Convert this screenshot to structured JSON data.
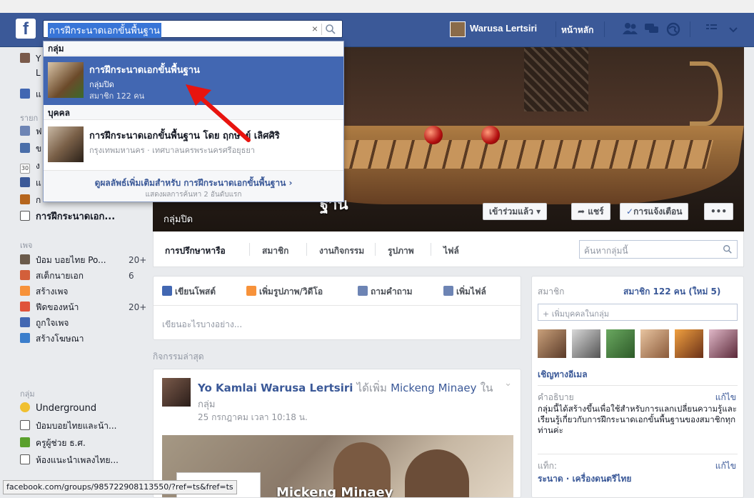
{
  "topbar": {
    "search_value": "การฝึกระนาดเอกขั้นพื้นฐาน",
    "clear_glyph": "×",
    "profile_name": "Warusa Lertsiri",
    "home_label": "หน้าหลัก"
  },
  "dropdown": {
    "groups_header": "กลุ่ม",
    "group_result": {
      "title": "การฝึกระนาดเอกขั้นพื้นฐาน",
      "privacy": "กลุ่มปิด",
      "members": "สมาชิก 122 คน"
    },
    "people_header": "บุคคล",
    "person_result": {
      "title": "การฝึกระนาดเอกขั้นพื้นฐาน โดย ฤกษาย์ เลิศศิริ",
      "location": "กรุงเทพมหานคร · เทศบาลนครพระนครศรีอยุธยา"
    },
    "more_results": "ดูผลลัพธ์เพิ่มเติมสำหรับ การฝึกระนาดเอกขั้นพื้นฐาน ›",
    "more_results_sub": "แสดงผลการค้นหา 2 อันดับแรก"
  },
  "sidebar": {
    "top_initial_1": "Y",
    "top_initial_2": "L",
    "letter_w": "แ",
    "section_list": "รายก",
    "shortcut_1": "ฟ",
    "shortcut_2": "ข",
    "shortcut_3": "ง",
    "shortcut_4": "แ",
    "shortcut_5": "ก",
    "calendar_num": "30",
    "group_shortcut": "การฝึกระนาดเอก...",
    "pages_header": "เพจ",
    "pages": [
      {
        "label": "ป๋อม บอยไทย Po...",
        "count": "20+"
      },
      {
        "label": "สเต็กนายเอก",
        "count": "6"
      },
      {
        "label": "สร้างเพจ",
        "count": ""
      },
      {
        "label": "ฟีดของหน้า",
        "count": "20+"
      },
      {
        "label": "ถูกใจเพจ",
        "count": ""
      },
      {
        "label": "สร้างโฆษณา",
        "count": ""
      }
    ],
    "groups_header": "กลุ่ม",
    "groups": [
      {
        "label": "Underground"
      },
      {
        "label": "ป๋อมบอยไทยและน้า..."
      },
      {
        "label": "ครูผู้ช่วย ธ.ศ."
      },
      {
        "label": "ห้องแนะนำเพลงไทย..."
      }
    ]
  },
  "cover": {
    "title_fragment": "ฐาน",
    "subtitle": "กลุ่มปิด",
    "joined_button": "เข้าร่วมแล้ว ▾",
    "share_button": "แชร์",
    "notify_button": "การแจ้งเตือน",
    "more_button": "•••"
  },
  "tabs": {
    "items": [
      "การปรึกษาหารือ",
      "สมาชิก",
      "งานกิจกรรม",
      "รูปภาพ",
      "ไฟล์"
    ],
    "search_placeholder": "ค้นหากลุ่มนี้"
  },
  "composer": {
    "write_post": "เขียนโพสต์",
    "add_photo": "เพิ่มรูปภาพ/วิดีโอ",
    "ask_question": "ถามคำถาม",
    "add_file": "เพิ่มไฟล์",
    "placeholder": "เขียนอะไรบางอย่าง..."
  },
  "recent_activity_label": "กิจกรรมล่าสุด",
  "post": {
    "author": "Yo Kamlai Warusa Lertsiri",
    "action": "ได้เพิ่ม",
    "target": "Mickeng Minaey",
    "in_word": "ใน",
    "line2": "กลุ่ม",
    "time": "25 กรกฎาคม เวลา 10:18 น.",
    "photo_caption": "Mickeng Minaey"
  },
  "right": {
    "members_label": "สมาชิก",
    "members_count": "สมาชิก 122 คน (ใหม่ 5)",
    "add_member_placeholder": "+ เพิ่มบุคคลในกลุ่ม",
    "invite_email": "เชิญทางอีเมล",
    "description_label": "คำอธิบาย",
    "edit_label": "แก้ไข",
    "description": "กลุ่มนี้ได้สร้างขึ้นเพื่อใช้สำหรับการแลกเปลี่ยนความรู้และเรียนรู้เกี่ยวกับการฝึกระนาดเอกขั้นพื้นฐานของสมาชิกทุกท่านค่ะ",
    "tags_label": "แท็ก:",
    "tags_edit": "แก้ไข",
    "tags_value": "ระนาด · เครื่องดนตรีไทย"
  },
  "status_url": "facebook.com/groups/985722908113550/?ref=ts&fref=ts",
  "colors": {
    "brand_blue": "#3b5998",
    "selected_blue": "#4267b2",
    "annotation_red": "#e8140f"
  }
}
